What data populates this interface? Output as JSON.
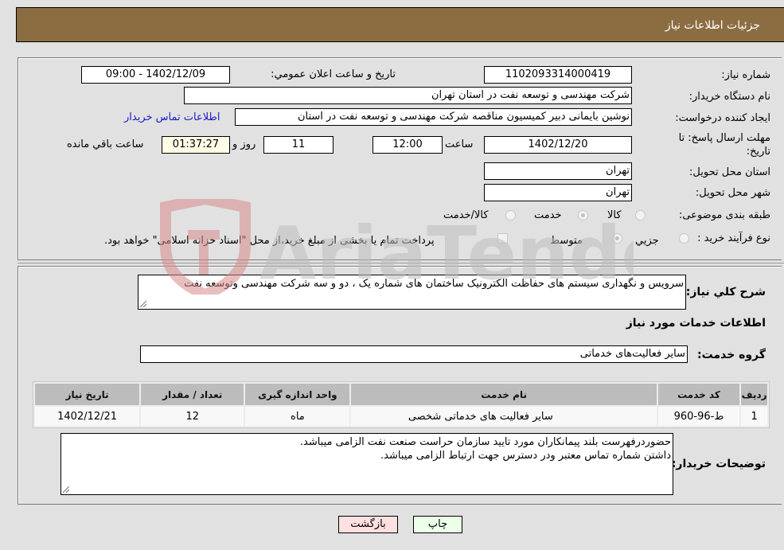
{
  "header": {
    "title": "جزئیات اطلاعات نیاز"
  },
  "details": {
    "need_number": {
      "label": "شماره نیاز:",
      "value": "1102093314000419"
    },
    "announce_datetime": {
      "label": "تاریخ و ساعت اعلان عمومي:",
      "value": "1402/12/09 - 09:00"
    },
    "buyer_org": {
      "label": "نام دستگاه خریدار:",
      "value": "شرکت مهندسی و توسعه نفت در استان تهران"
    },
    "requester": {
      "label": "ایجاد کننده درخواست:",
      "value": "نوشین بایمانی دبیر کمیسیون مناقصه شرکت مهندسی و توسعه نفت در استان"
    },
    "buyer_contact_link": "اطلاعات تماس خریدار",
    "deadline": {
      "label": "مهلت ارسال پاسخ: تا تاریخ:",
      "date": "1402/12/20",
      "time_label": "ساعت",
      "time": "12:00",
      "days": "11",
      "days_label": "روز و",
      "remaining": "01:37:27",
      "remaining_label": "ساعت باقي مانده"
    },
    "delivery_province": {
      "label": "استان محل تحویل:",
      "value": "تهران"
    },
    "delivery_city": {
      "label": "شهر محل تحویل:",
      "value": "تهران"
    },
    "category": {
      "label": "طبقه بندی موضوعی:",
      "options": [
        {
          "label": "کالا",
          "checked": false
        },
        {
          "label": "خدمت",
          "checked": true
        },
        {
          "label": "کالا/خدمت",
          "checked": false
        }
      ]
    },
    "purchase_process": {
      "label": "نوع فرآیند خرید :",
      "options": [
        {
          "label": "جزيي",
          "checked": false
        },
        {
          "label": "متوسط",
          "checked": true
        }
      ],
      "treasury_note": "پرداخت تمام یا بخشی از مبلغ خرید،از محل \"اسناد خزانه اسلامی\" خواهد بود."
    }
  },
  "summary": {
    "label": "شرح كلي نياز:",
    "value": "سرویس و نگهداری سیستم های حفاظت الکترونیک ساختمان های شماره یک ، دو و سه شرکت مهندسی وتوسعه نفت"
  },
  "services": {
    "section_title": "اطلاعات خدمات مورد نياز",
    "group_label": "گروه خدمت:",
    "group_value": "سایر فعالیت‌های خدماتی",
    "table": {
      "headers": [
        "ردیف",
        "کد خدمت",
        "نام خدمت",
        "واحد اندازه گیری",
        "تعداد / مقدار",
        "تاریخ نیاز"
      ],
      "rows": [
        [
          "1",
          "ط-96-960",
          "سایر فعالیت های خدماتی شخصی",
          "ماه",
          "12",
          "1402/12/21"
        ]
      ]
    }
  },
  "buyer_notes": {
    "label": "توضیحات خریدار:",
    "lines": [
      "حضوردرفهرست بلند پیمانکاران مورد تایید سازمان حراست صنعت نفت الزامی میباشد.",
      "داشتن شماره تماس معتبر ودر دسترس جهت ارتباط الزامی میباشد."
    ]
  },
  "buttons": {
    "print": "چاپ",
    "back": "بازگشت"
  },
  "watermark": {
    "text": "AriaTender.neT"
  },
  "colors": {
    "header_bg": "#8c6d42",
    "link": "#1a1acd",
    "back_btn": "#ffe0e0",
    "print_btn": "#ecffe8"
  }
}
